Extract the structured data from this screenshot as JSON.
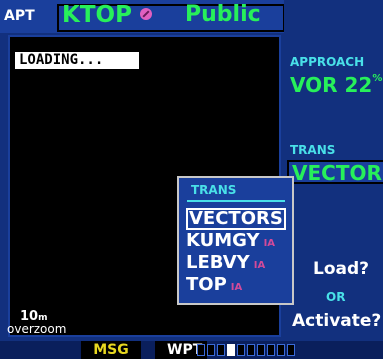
{
  "header": {
    "tag": "APT",
    "airport_id": "KTOP",
    "airport_type": "Public"
  },
  "map": {
    "status": "LOADING...",
    "zoom": "10",
    "zoom_unit": "m",
    "zoom_mode": "overzoom"
  },
  "right_panel": {
    "approach_label": "APPROACH",
    "approach_value": "VOR 22",
    "approach_suffix": "%",
    "trans_label": "TRANS",
    "trans_value": "VECTORS",
    "load_prompt": "Load?",
    "or_text": "OR",
    "activate_prompt": "Activate?"
  },
  "popup": {
    "title": "TRANS",
    "items": [
      {
        "label": "VECTORS",
        "tag": "",
        "selected": true
      },
      {
        "label": "KUMGY",
        "tag": "IA",
        "selected": false
      },
      {
        "label": "LEBVY",
        "tag": "IA",
        "selected": false
      },
      {
        "label": "TOP",
        "tag": "IA",
        "selected": false
      }
    ]
  },
  "status_bar": {
    "msg": "MSG",
    "wpt": "WPT",
    "page_count": 10,
    "active_page": 4
  },
  "colors": {
    "green": "#27f05a",
    "cyan": "#49e0e8",
    "magenta": "#d24a9a",
    "yellow": "#e8d820"
  }
}
